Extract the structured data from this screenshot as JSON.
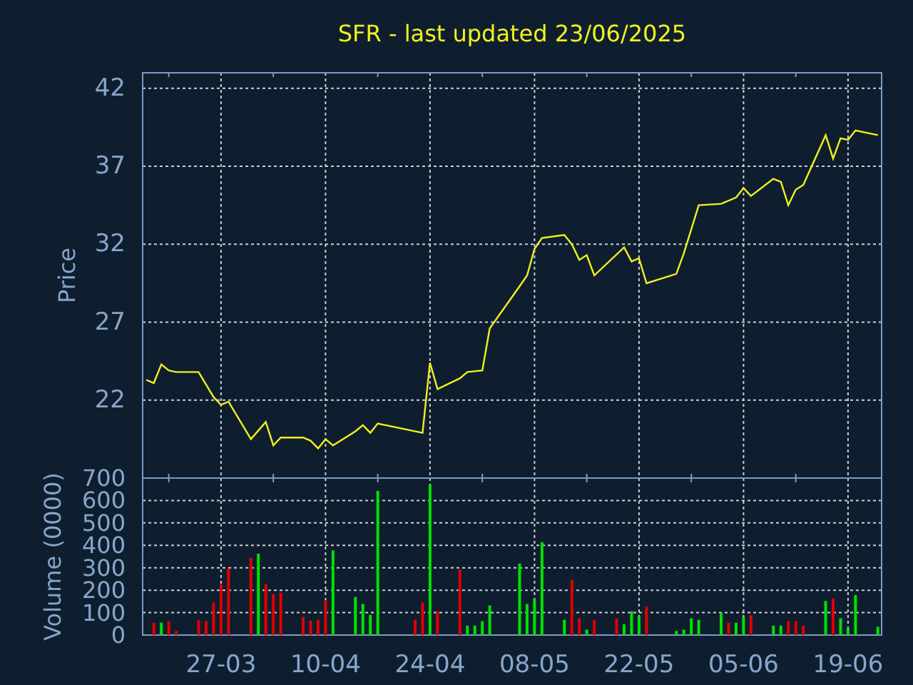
{
  "title": "SFR - last updated 23/06/2025",
  "price_chart": {
    "chart_data": {
      "type": "line",
      "ylabel": "Price",
      "categories": [
        null,
        null,
        null,
        null,
        null,
        null,
        null,
        null,
        null,
        null,
        null,
        null,
        null,
        null,
        null,
        null,
        null,
        null,
        null,
        null,
        null,
        null,
        null,
        null,
        null,
        null,
        null,
        null,
        null,
        null,
        null,
        null,
        null,
        null,
        null,
        null,
        null,
        null,
        null,
        null,
        null,
        null,
        null,
        null,
        null,
        null,
        null,
        null,
        null,
        null,
        null,
        null,
        null,
        null,
        null,
        null,
        null,
        null,
        null,
        null,
        null,
        null,
        null,
        null,
        null,
        null,
        null,
        null,
        null,
        null,
        null,
        null,
        null,
        null,
        null,
        null,
        null,
        null,
        null,
        null,
        null,
        null,
        null,
        null,
        null,
        null,
        null,
        null,
        null,
        null,
        null,
        null,
        null,
        null,
        null,
        null,
        null,
        null,
        null
      ],
      "series": [
        {
          "color": "#f0f020",
          "values": [
            23.3,
            23.1,
            24.3,
            23.9,
            23.8,
            null,
            null,
            23.8,
            null,
            22.2,
            21.7,
            21.9,
            null,
            null,
            19.5,
            null,
            20.6,
            19.1,
            19.6,
            null,
            null,
            19.6,
            19.4,
            18.9,
            19.5,
            19.1,
            null,
            null,
            20.0,
            20.4,
            19.9,
            20.5,
            null,
            null,
            null,
            null,
            null,
            19.9,
            24.4,
            22.7,
            null,
            null,
            23.4,
            23.8,
            null,
            23.9,
            26.6,
            null,
            null,
            null,
            29.3,
            30.0,
            31.7,
            32.4,
            null,
            null,
            32.6,
            32.0,
            31.0,
            31.3,
            30.0,
            null,
            null,
            null,
            31.8,
            30.9,
            31.1,
            29.5,
            null,
            null,
            null,
            30.1,
            31.4,
            null,
            34.5,
            null,
            null,
            34.6,
            null,
            35.0,
            35.6,
            35.1,
            null,
            null,
            36.2,
            36.0,
            34.5,
            35.5,
            35.8,
            null,
            null,
            39.0,
            37.5,
            38.8,
            38.7,
            39.3,
            null,
            null,
            39.0
          ]
        }
      ],
      "ylim": [
        17,
        43
      ],
      "grid": true,
      "yticks": [
        22,
        27,
        32,
        37,
        42
      ]
    }
  },
  "volume_chart": {
    "chart_data": {
      "type": "bar",
      "ylabel": "Volume (0000)",
      "categories": [
        null,
        null,
        null,
        null,
        null,
        null,
        null,
        null,
        null,
        null,
        "27-03",
        null,
        null,
        null,
        null,
        null,
        null,
        null,
        null,
        null,
        null,
        null,
        null,
        null,
        "10-04",
        null,
        null,
        null,
        null,
        null,
        null,
        null,
        null,
        null,
        null,
        null,
        null,
        null,
        "24-04",
        null,
        null,
        null,
        null,
        null,
        null,
        null,
        null,
        null,
        null,
        null,
        null,
        null,
        "08-05",
        null,
        null,
        null,
        null,
        null,
        null,
        null,
        null,
        null,
        null,
        null,
        null,
        null,
        "22-05",
        null,
        null,
        null,
        null,
        null,
        null,
        null,
        null,
        null,
        null,
        null,
        null,
        null,
        "05-06",
        null,
        null,
        null,
        null,
        null,
        null,
        null,
        null,
        null,
        null,
        null,
        null,
        null,
        "19-06",
        null,
        null,
        null,
        null
      ],
      "series": [
        {
          "color": "#00e000",
          "values": [
            null,
            null,
            55,
            null,
            null,
            null,
            null,
            null,
            null,
            null,
            null,
            null,
            null,
            null,
            null,
            363,
            null,
            null,
            null,
            null,
            null,
            null,
            null,
            null,
            null,
            377,
            null,
            null,
            170,
            139,
            90,
            643,
            null,
            null,
            null,
            null,
            null,
            null,
            672,
            null,
            null,
            null,
            null,
            42,
            42,
            62,
            132,
            null,
            null,
            null,
            319,
            139,
            163,
            414,
            null,
            null,
            68,
            null,
            null,
            24,
            null,
            null,
            null,
            null,
            48,
            106,
            84,
            null,
            null,
            null,
            null,
            18,
            24,
            75,
            68,
            null,
            null,
            99,
            null,
            55,
            81,
            null,
            null,
            null,
            42,
            42,
            null,
            null,
            null,
            null,
            null,
            152,
            null,
            75,
            31,
            178,
            null,
            null,
            37
          ]
        },
        {
          "color": "#e00000",
          "values": [
            null,
            55,
            null,
            62,
            18,
            null,
            null,
            68,
            62,
            145,
            227,
            297,
            null,
            null,
            344,
            null,
            227,
            183,
            189,
            null,
            null,
            81,
            64,
            68,
            156,
            null,
            null,
            null,
            null,
            null,
            null,
            null,
            null,
            null,
            null,
            null,
            68,
            145,
            null,
            106,
            null,
            null,
            293,
            null,
            null,
            null,
            null,
            null,
            null,
            null,
            null,
            null,
            null,
            null,
            null,
            null,
            null,
            247,
            75,
            null,
            68,
            null,
            null,
            75,
            null,
            null,
            null,
            126,
            null,
            null,
            null,
            null,
            null,
            null,
            null,
            null,
            null,
            null,
            55,
            null,
            null,
            88,
            null,
            null,
            null,
            null,
            62,
            62,
            42,
            null,
            null,
            null,
            163,
            null,
            null,
            null,
            null,
            null,
            null
          ]
        }
      ],
      "ylim": [
        0,
        700
      ],
      "grid": true,
      "yticks": [
        0,
        100,
        200,
        300,
        400,
        500,
        600,
        700
      ]
    }
  }
}
